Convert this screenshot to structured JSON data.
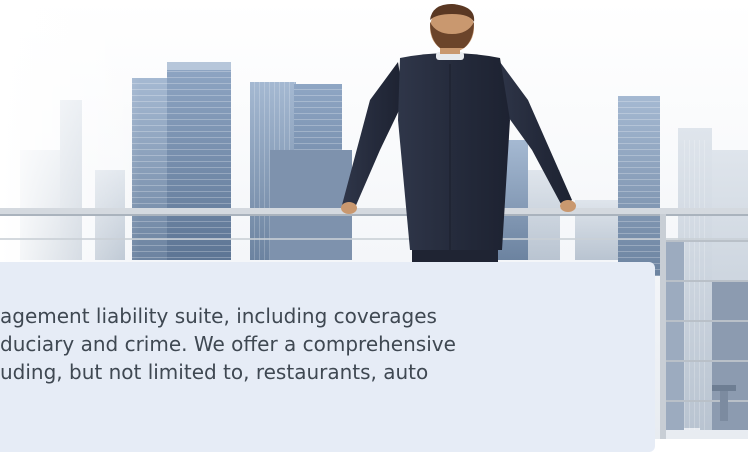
{
  "hero": {
    "image_label": "man-on-balcony-city-skyline"
  },
  "card": {
    "lines": [
      "agement liability suite, including coverages",
      "duciary and crime. We offer a comprehensive",
      "uding, but not limited to, restaurants, auto"
    ]
  },
  "colors": {
    "card_background": "#e6ecf6",
    "text": "#3f4852",
    "suit": "#262c3e"
  }
}
